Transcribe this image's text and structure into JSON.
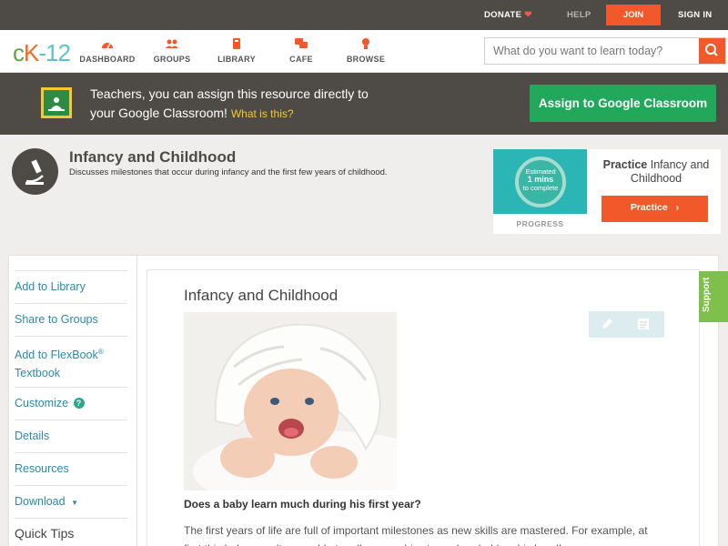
{
  "topbar": {
    "donate": "DONATE",
    "help": "HELP",
    "join": "JOIN",
    "signin": "SIGN IN"
  },
  "nav": {
    "items": [
      {
        "label": "DASHBOARD",
        "icon": "dashboard-icon"
      },
      {
        "label": "GROUPS",
        "icon": "groups-icon"
      },
      {
        "label": "LIBRARY",
        "icon": "library-icon"
      },
      {
        "label": "CAFE",
        "icon": "cafe-icon"
      },
      {
        "label": "BROWSE",
        "icon": "browse-icon"
      }
    ],
    "search_placeholder": "What do you want to learn today?"
  },
  "banner": {
    "line1": "Teachers, you can assign this resource directly to",
    "line2": "your Google Classroom!",
    "what": "What is this?",
    "assign": "Assign to Google Classroom"
  },
  "concept": {
    "title": "Infancy and Childhood",
    "description": "Discusses milestones that occur during infancy and the first few years of childhood."
  },
  "practice": {
    "estimated": "Estimated",
    "mins": "1 mins",
    "to_complete": "to complete",
    "progress": "PROGRESS",
    "title_bold": "Practice",
    "title_rest": "Infancy and Childhood",
    "button": "Practice"
  },
  "sidebar": {
    "items": [
      "Add to Library",
      "Share to Groups",
      "Add to FlexBook® Textbook",
      "Customize",
      "Details",
      "Resources",
      "Download"
    ],
    "flexbook_line1": "Add to FlexBook",
    "flexbook_reg": "®",
    "flexbook_line2": "Textbook",
    "quick_tips": "Quick Tips"
  },
  "article": {
    "title": "Infancy and Childhood",
    "question": "Does a baby learn much during his first year?",
    "paragraph": "The first years of life are full of important milestones as new skills are mastered. For example, at first this baby wasn't even able to roll over on his stomach or hold up his head!"
  },
  "support": "Support",
  "colors": {
    "accent": "#f2592a",
    "dark": "#4e4b46",
    "link": "#2a8aaa",
    "google_green": "#22a85a",
    "support_green": "#7ec04b"
  }
}
